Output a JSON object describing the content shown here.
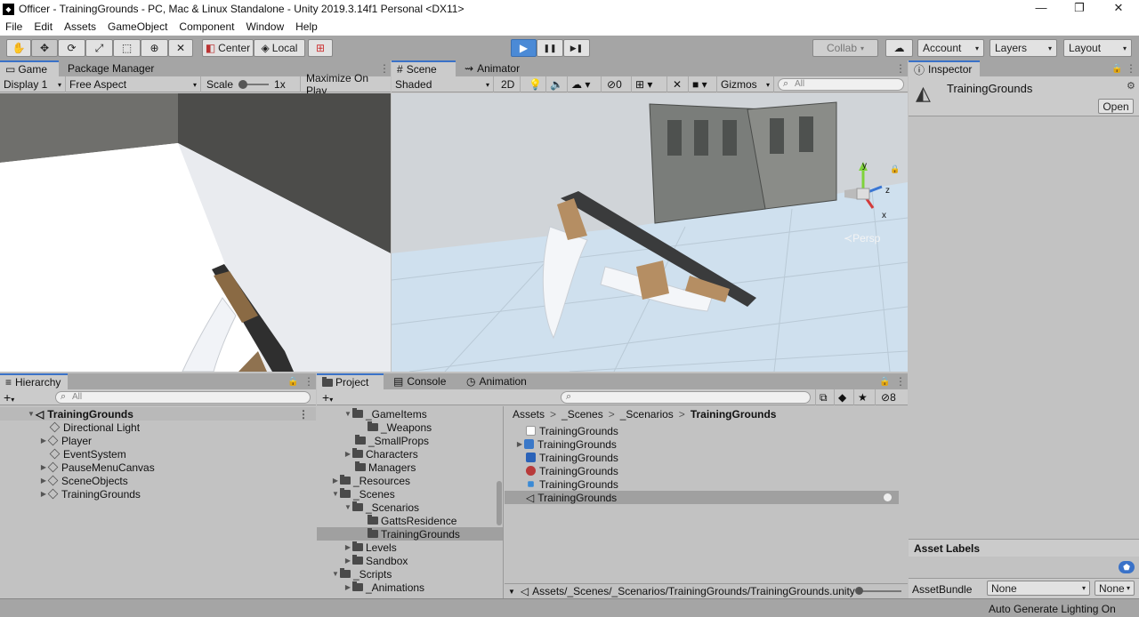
{
  "window": {
    "title": "Officer - TrainingGrounds - PC, Mac & Linux Standalone - Unity 2019.3.14f1 Personal <DX11>",
    "min": "—",
    "restore": "❐",
    "close": "✕"
  },
  "menu": [
    "File",
    "Edit",
    "Assets",
    "GameObject",
    "Component",
    "Window",
    "Help"
  ],
  "toolbar": {
    "tools": [
      "hand-tool",
      "move-tool",
      "rotate-tool",
      "scale-tool",
      "rect-tool",
      "transform-tool",
      "custom-tool"
    ],
    "pivot": "Center",
    "space": "Local",
    "play": "▶",
    "pause": "❚❚",
    "step": "▶❚",
    "collab": "Collab",
    "account": "Account",
    "layers": "Layers",
    "layout": "Layout"
  },
  "game": {
    "tabs": [
      "Game",
      "Package Manager"
    ],
    "display": "Display 1",
    "aspect": "Free Aspect",
    "scale_label": "Scale",
    "scale_value": "1x",
    "maximize": "Maximize On Play"
  },
  "scene": {
    "tabs": [
      "Scene",
      "Animator"
    ],
    "shading": "Shaded",
    "mode2d": "2D",
    "hidden_count": "0",
    "gizmos": "Gizmos",
    "search_placeholder": "All",
    "persp": "Persp",
    "axis_y": "y",
    "axis_z": "z",
    "axis_x": "x"
  },
  "inspector": {
    "tab": "Inspector",
    "object": "TrainingGrounds",
    "open": "Open",
    "asset_labels": "Asset Labels",
    "asset_bundle": "AssetBundle",
    "bundle_value": "None",
    "variant_value": "None"
  },
  "hierarchy": {
    "tab": "Hierarchy",
    "search_placeholder": "All",
    "scene": "TrainingGrounds",
    "items": [
      "Directional Light",
      "Player",
      "EventSystem",
      "PauseMenuCanvas",
      "SceneObjects",
      "TrainingGrounds"
    ]
  },
  "project": {
    "tabs": [
      "Project",
      "Console",
      "Animation"
    ],
    "hidden_count": "8",
    "folders": [
      "_GameItems",
      "_Weapons",
      "_SmallProps",
      "Characters",
      "Managers",
      "_Resources",
      "_Scenes",
      "_Scenarios",
      "GattsResidence",
      "TrainingGrounds",
      "Levels",
      "Sandbox",
      "_Scripts",
      "_Animations"
    ],
    "breadcrumb": [
      "Assets",
      "_Scenes",
      "_Scenarios",
      "TrainingGrounds"
    ],
    "files": [
      "TrainingGrounds",
      "TrainingGrounds",
      "TrainingGrounds",
      "TrainingGrounds",
      "TrainingGrounds",
      "TrainingGrounds"
    ],
    "path": "Assets/_Scenes/_Scenarios/TrainingGrounds/TrainingGrounds.unity"
  },
  "status": {
    "text": "Auto Generate Lighting On"
  },
  "colors": {
    "accent": "#3a72c8",
    "play": "#4b8ad6",
    "panel": "#c2c2c2",
    "toolbar": "#a5a5a5"
  }
}
